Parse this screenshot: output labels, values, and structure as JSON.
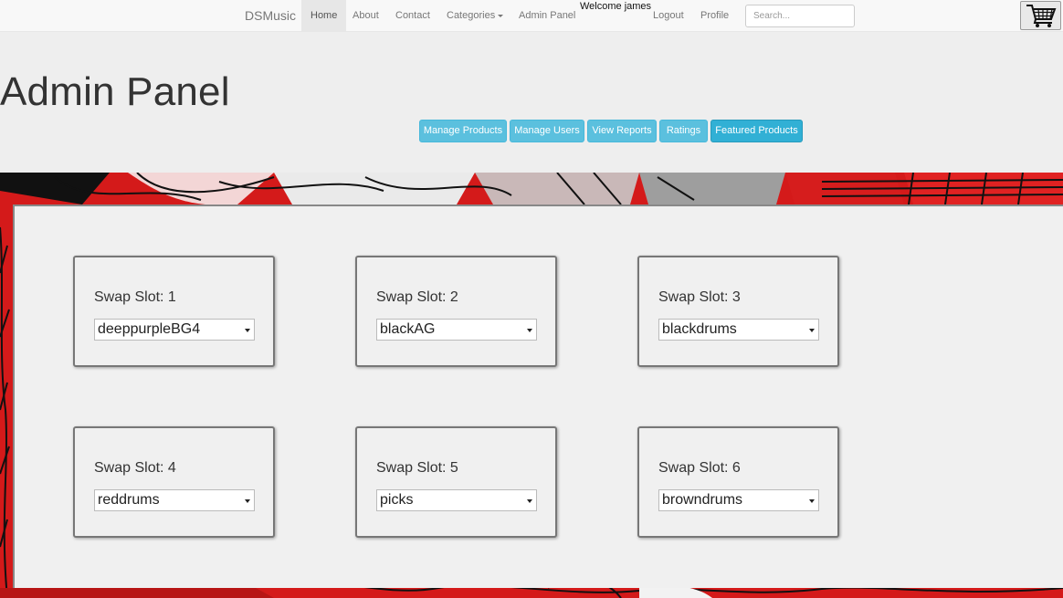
{
  "navbar": {
    "brand": "DSMusic",
    "items": [
      {
        "label": "Home",
        "active": true
      },
      {
        "label": "About"
      },
      {
        "label": "Contact"
      },
      {
        "label": "Categories",
        "dropdown": true
      },
      {
        "label": "Admin Panel"
      }
    ],
    "welcome": "Welcome james",
    "logout": "Logout",
    "profile": "Profile",
    "search_placeholder": "Search...",
    "cart_icon": "shopping-cart-icon"
  },
  "page": {
    "title": "Admin Panel"
  },
  "admin_buttons": [
    {
      "label": "Manage Products"
    },
    {
      "label": "Manage Users"
    },
    {
      "label": "View Reports"
    },
    {
      "label": "Ratings"
    },
    {
      "label": "Featured Products",
      "active": true
    }
  ],
  "slots": [
    {
      "label": "Swap Slot: 1",
      "value": "deeppurpleBG4"
    },
    {
      "label": "Swap Slot: 2",
      "value": "blackAG"
    },
    {
      "label": "Swap Slot: 3",
      "value": "blackdrums"
    },
    {
      "label": "Swap Slot: 4",
      "value": "reddrums"
    },
    {
      "label": "Swap Slot: 5",
      "value": "picks"
    },
    {
      "label": "Swap Slot: 6",
      "value": "browndrums"
    }
  ],
  "colors": {
    "button_info": "#5bc0de",
    "button_info_active": "#31b0d5",
    "banner_red": "#d01818",
    "navbar_bg": "#f8f8f8"
  }
}
